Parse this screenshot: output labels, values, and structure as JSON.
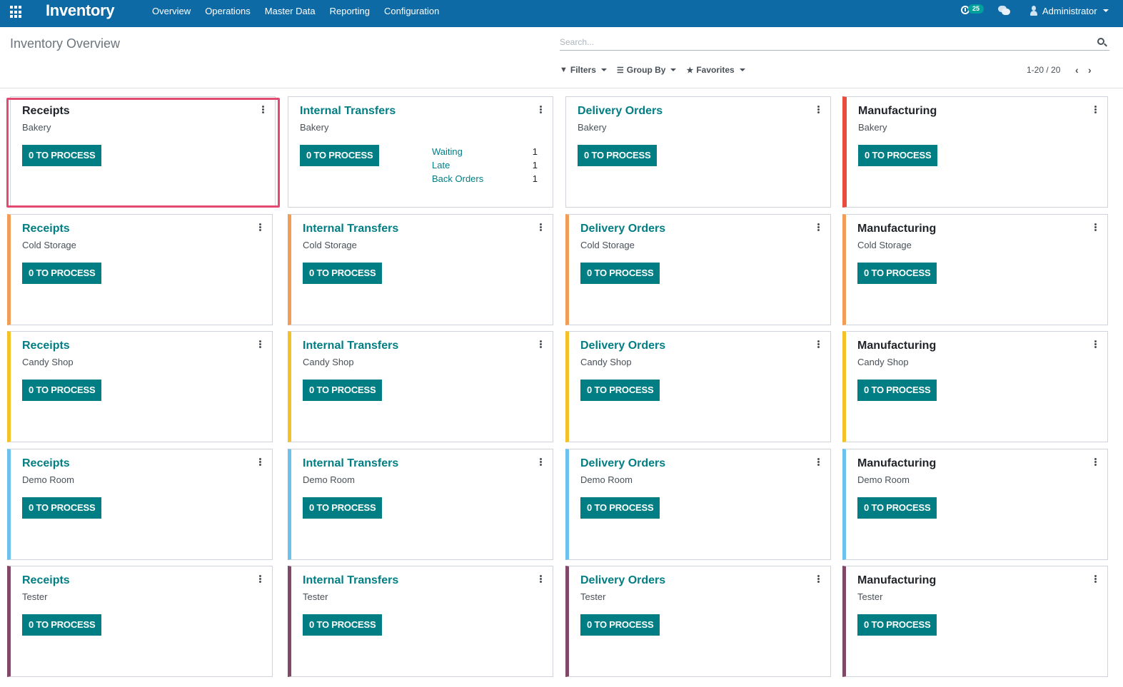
{
  "navbar": {
    "app_name": "Inventory",
    "menu": [
      "Overview",
      "Operations",
      "Master Data",
      "Reporting",
      "Configuration"
    ],
    "activity_count": "25",
    "user_name": "Administrator",
    "color": "#0e6aa4"
  },
  "control_panel": {
    "title": "Inventory Overview",
    "search_placeholder": "Search...",
    "filters_label": "Filters",
    "group_by_label": "Group By",
    "favorites_label": "Favorites",
    "pager_value": "1-20 / 20"
  },
  "button_label": "0 TO PROCESS",
  "accent": "#017e84",
  "cards": [
    {
      "title": "Receipts",
      "warehouse": "Bakery",
      "row": 0,
      "color": "none",
      "dark": true,
      "stats": []
    },
    {
      "title": "Internal Transfers",
      "warehouse": "Bakery",
      "row": 0,
      "color": "none",
      "dark": false,
      "stats": [
        {
          "label": "Waiting",
          "value": "1"
        },
        {
          "label": "Late",
          "value": "1"
        },
        {
          "label": "Back Orders",
          "value": "1"
        }
      ]
    },
    {
      "title": "Delivery Orders",
      "warehouse": "Bakery",
      "row": 0,
      "color": "none",
      "dark": false,
      "stats": []
    },
    {
      "title": "Manufacturing",
      "warehouse": "Bakery",
      "row": 0,
      "color": "#e74c3c",
      "dark": true,
      "stats": []
    },
    {
      "title": "Receipts",
      "warehouse": "Cold Storage",
      "row": 1,
      "color": "#f19d57",
      "dark": false,
      "stats": []
    },
    {
      "title": "Internal Transfers",
      "warehouse": "Cold Storage",
      "row": 1,
      "color": "#f19d57",
      "dark": false,
      "stats": []
    },
    {
      "title": "Delivery Orders",
      "warehouse": "Cold Storage",
      "row": 1,
      "color": "#f19d57",
      "dark": false,
      "stats": []
    },
    {
      "title": "Manufacturing",
      "warehouse": "Cold Storage",
      "row": 1,
      "color": "#f19d57",
      "dark": true,
      "stats": []
    },
    {
      "title": "Receipts",
      "warehouse": "Candy Shop",
      "row": 2,
      "color": "#f4c128",
      "dark": false,
      "stats": []
    },
    {
      "title": "Internal Transfers",
      "warehouse": "Candy Shop",
      "row": 2,
      "color": "#f4c128",
      "dark": false,
      "stats": []
    },
    {
      "title": "Delivery Orders",
      "warehouse": "Candy Shop",
      "row": 2,
      "color": "#f4c128",
      "dark": false,
      "stats": []
    },
    {
      "title": "Manufacturing",
      "warehouse": "Candy Shop",
      "row": 2,
      "color": "#f4c128",
      "dark": true,
      "stats": []
    },
    {
      "title": "Receipts",
      "warehouse": "Demo Room",
      "row": 3,
      "color": "#6cc1ed",
      "dark": false,
      "stats": []
    },
    {
      "title": "Internal Transfers",
      "warehouse": "Demo Room",
      "row": 3,
      "color": "#6cc1ed",
      "dark": false,
      "stats": []
    },
    {
      "title": "Delivery Orders",
      "warehouse": "Demo Room",
      "row": 3,
      "color": "#6cc1ed",
      "dark": false,
      "stats": []
    },
    {
      "title": "Manufacturing",
      "warehouse": "Demo Room",
      "row": 3,
      "color": "#6cc1ed",
      "dark": true,
      "stats": []
    },
    {
      "title": "Receipts",
      "warehouse": "Tester",
      "row": 4,
      "color": "#814968",
      "dark": false,
      "stats": []
    },
    {
      "title": "Internal Transfers",
      "warehouse": "Tester",
      "row": 4,
      "color": "#814968",
      "dark": false,
      "stats": []
    },
    {
      "title": "Delivery Orders",
      "warehouse": "Tester",
      "row": 4,
      "color": "#814968",
      "dark": false,
      "stats": []
    },
    {
      "title": "Manufacturing",
      "warehouse": "Tester",
      "row": 4,
      "color": "#814968",
      "dark": true,
      "stats": []
    }
  ],
  "highlighted_card": "Receipts Bakery"
}
